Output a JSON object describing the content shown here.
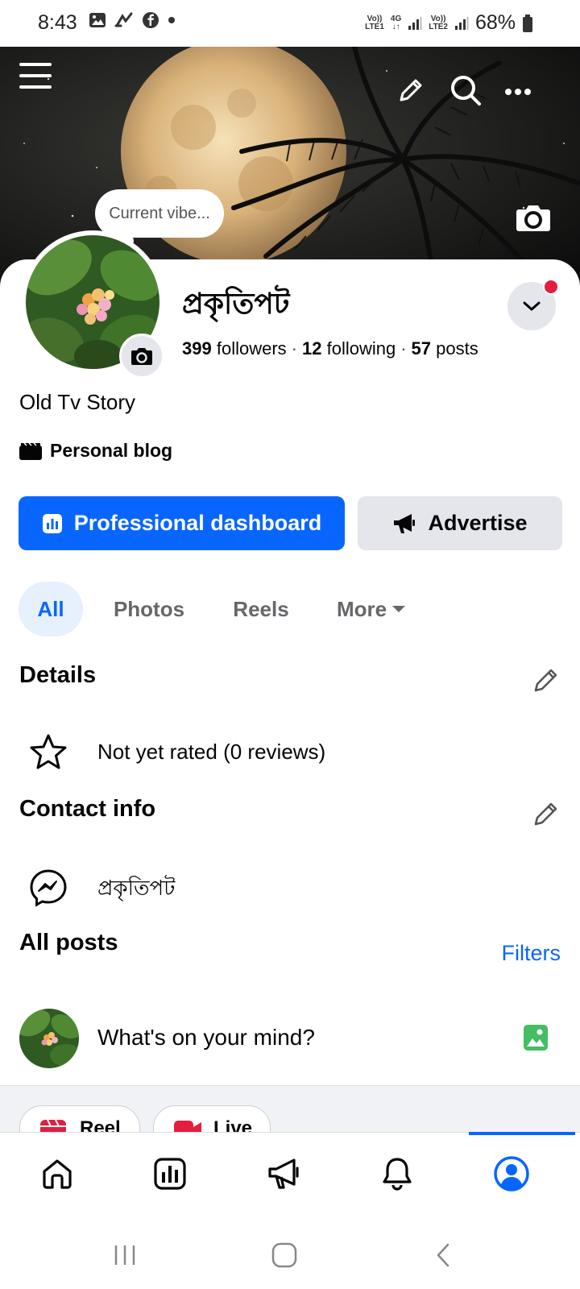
{
  "status_bar": {
    "time": "8:43",
    "battery": "68%",
    "sim1_label_top": "Vo))",
    "sim1_label_bottom": "LTE1",
    "network": "4G",
    "sim2_label_top": "Vo))",
    "sim2_label_bottom": "LTE2"
  },
  "cover": {
    "bubble_text": "Current vibe..."
  },
  "profile": {
    "name": "প্রকৃতিপট",
    "followers_count": "399",
    "followers_label": "followers",
    "following_count": "12",
    "following_label": "following",
    "posts_count": "57",
    "posts_label": "posts",
    "bio": "Old Tv Story",
    "category": "Personal blog"
  },
  "actions": {
    "primary_label": "Professional dashboard",
    "secondary_label": "Advertise"
  },
  "tabs": [
    {
      "label": "All",
      "active": true
    },
    {
      "label": "Photos",
      "active": false
    },
    {
      "label": "Reels",
      "active": false
    },
    {
      "label": "More",
      "active": false
    }
  ],
  "details": {
    "title": "Details",
    "rating_text": "Not yet rated (0 reviews)"
  },
  "contact": {
    "title": "Contact info",
    "messenger_name": "প্রকৃতিপট"
  },
  "posts": {
    "title": "All posts",
    "filters_label": "Filters",
    "composer_placeholder": "What's on your mind?"
  },
  "composer_chips": [
    {
      "label": "Reel"
    },
    {
      "label": "Live"
    }
  ],
  "bottom_nav": [
    {
      "icon": "home-icon"
    },
    {
      "icon": "dashboard-icon"
    },
    {
      "icon": "megaphone-icon"
    },
    {
      "icon": "bell-icon"
    },
    {
      "icon": "profile-icon",
      "active": true
    }
  ],
  "colors": {
    "accent": "#0866ff",
    "secondary_button": "#e4e6eb",
    "notification": "#e41e3f",
    "photo_icon": "#45bd62"
  }
}
